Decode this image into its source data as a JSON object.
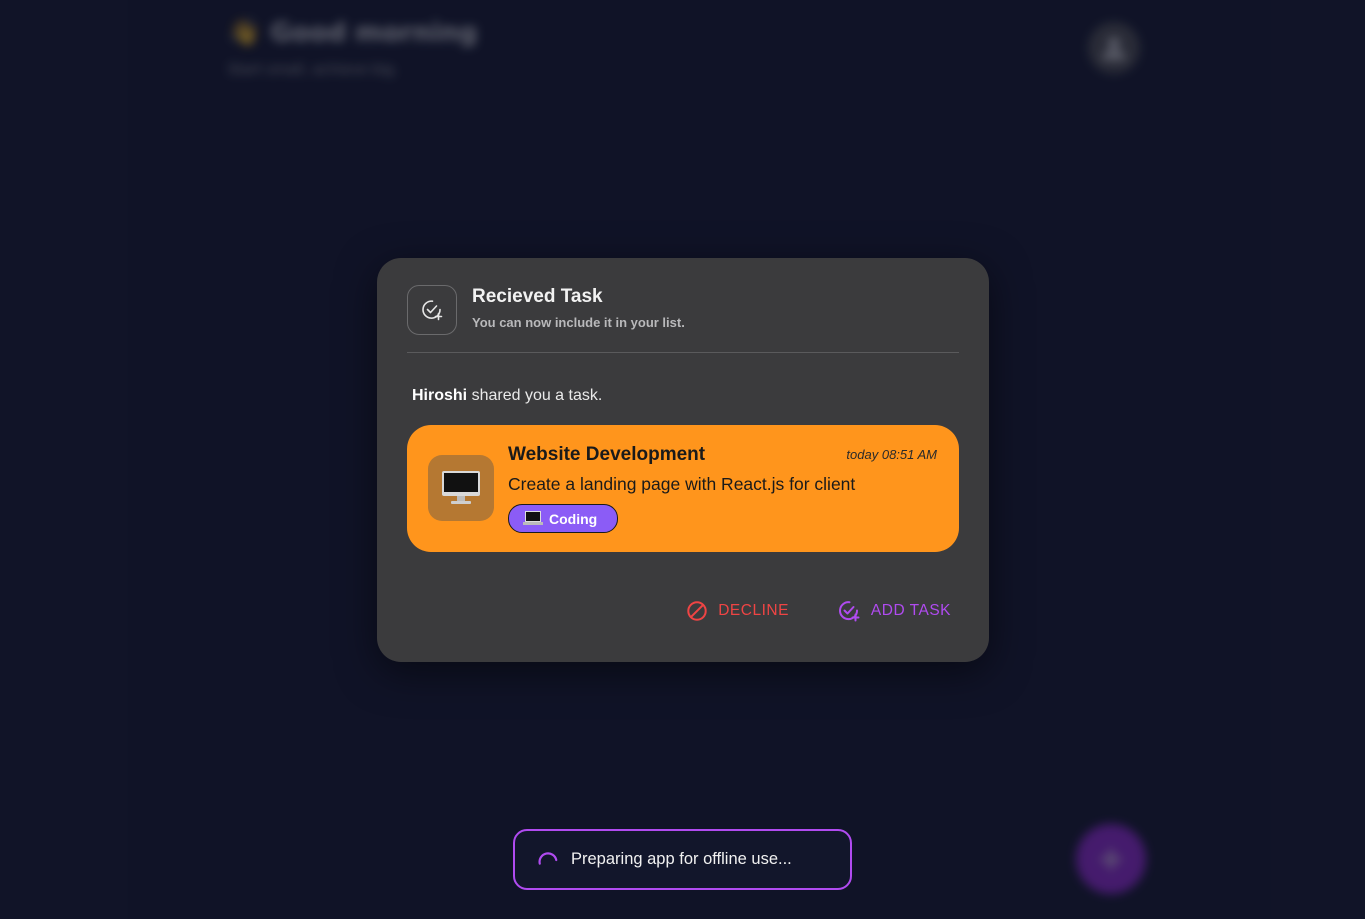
{
  "background": {
    "greeting_emoji": "👋",
    "greeting": "Good morning",
    "subtitle": "Start small, achieve big.",
    "fab_symbol": "+"
  },
  "dialog": {
    "title": "Recieved Task",
    "subtitle": "You can now include it in your list.",
    "sender": "Hiroshi",
    "shared_text": " shared you a task.",
    "task": {
      "emoji": "🖥️",
      "name": "Website Development",
      "date": "today 08:51 AM",
      "description": "Create a landing page with React.js for client",
      "category_emoji": "💻",
      "category": "Coding",
      "color": "#ff951c",
      "category_color": "#8b5cf6"
    },
    "decline_label": "DECLINE",
    "add_label": "ADD TASK"
  },
  "toast": {
    "text": "Preparing app for offline use..."
  },
  "colors": {
    "background": "#12162b",
    "dialog": "#3b3b3d",
    "accent": "#b04bf0",
    "decline": "#ef4444"
  }
}
